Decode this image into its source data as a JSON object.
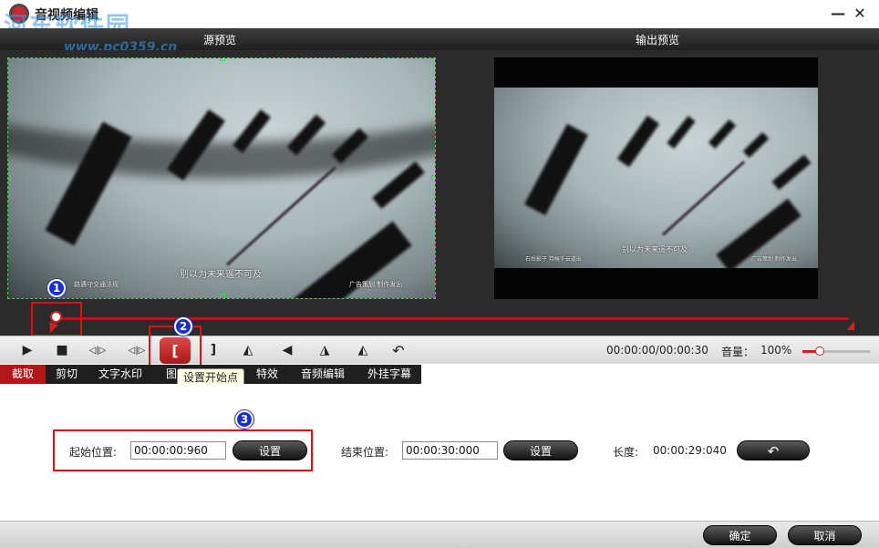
{
  "titlebar": {
    "title": "音视频编辑",
    "watermark": "河东软件园",
    "watermark_url": "www.pc0359.cn",
    "minimize": "—",
    "close": "✕"
  },
  "preview": {
    "source_label": "源预览",
    "output_label": "输出预览",
    "source_subtitle_left": "路遇守交通法规",
    "source_subtitle_center": "别以为未来遥不可及",
    "source_subtitle_right": "广告策划 制作发出",
    "output_subtitle_left": "石岳影子 持候千云道出",
    "output_subtitle_center": "别以为未来遥不可及",
    "output_subtitle_right": "广告策划 制作发出"
  },
  "timeline": {
    "start_position_fraction": 0.0
  },
  "controls": {
    "play_icon": "▶",
    "stop_icon": "■",
    "prev_frame_icon": "◁|▷",
    "next_frame_icon": "◁|▷",
    "set_start_icon": "[",
    "set_end_icon": "]",
    "flip_icon": "◭",
    "back_icon": "◀",
    "rotate_left_icon": "◮",
    "rotate_right_icon": "◭",
    "undo_icon": "↶",
    "time_readout": "00:00:00/00:00:30",
    "volume_label": "音量：",
    "volume_value": "100%",
    "volume_level": 0.25,
    "tooltip": "设置开始点"
  },
  "tabs": [
    {
      "label": "截取"
    },
    {
      "label": "剪切"
    },
    {
      "label": "文字水印"
    },
    {
      "label": "图"
    },
    {
      "label": "特效"
    },
    {
      "label": "音频编辑"
    },
    {
      "label": "外挂字幕"
    }
  ],
  "trim": {
    "start_label": "起始位置:",
    "start_value": "00:00:00:960",
    "set_label": "设置",
    "end_label": "结束位置:",
    "end_value": "00:00:30:000",
    "length_label": "长度:",
    "length_value": "00:00:29:040",
    "reset_icon": "↶"
  },
  "badges": {
    "one": "1",
    "two": "2",
    "three": "3"
  },
  "footer": {
    "ok": "确定",
    "cancel": "取消"
  },
  "colors": {
    "accent_red": "#b01818",
    "badge_blue": "#1a2fcf",
    "selection_green": "#33dd33"
  }
}
